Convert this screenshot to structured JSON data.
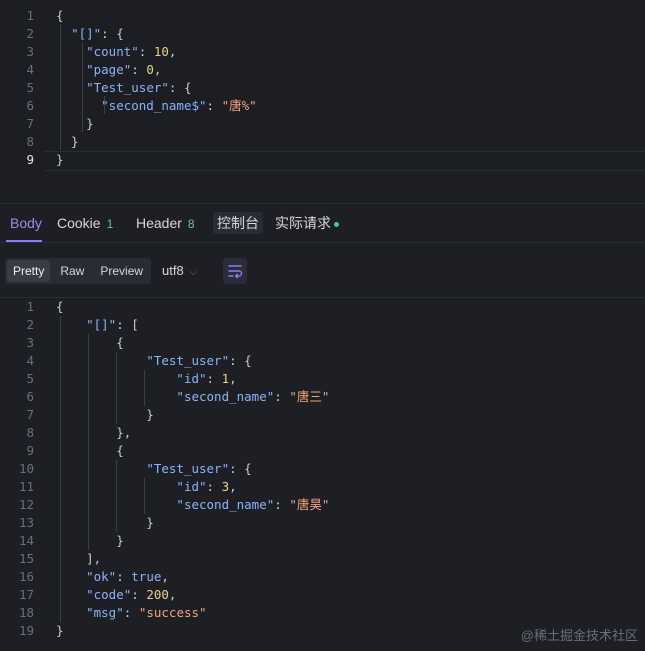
{
  "request_editor": {
    "line_numbers": [
      "1",
      "2",
      "3",
      "4",
      "5",
      "6",
      "7",
      "8",
      "9"
    ],
    "active_line": "9",
    "lines": [
      [
        {
          "t": "{",
          "c": "b"
        }
      ],
      [
        {
          "t": "  ",
          "c": "b"
        },
        {
          "t": "\"[]\"",
          "c": "k"
        },
        {
          "t": ": {",
          "c": "b"
        }
      ],
      [
        {
          "t": "    ",
          "c": "b"
        },
        {
          "t": "\"count\"",
          "c": "k"
        },
        {
          "t": ": ",
          "c": "b"
        },
        {
          "t": "10",
          "c": "n"
        },
        {
          "t": ",",
          "c": "b"
        }
      ],
      [
        {
          "t": "    ",
          "c": "b"
        },
        {
          "t": "\"page\"",
          "c": "k"
        },
        {
          "t": ": ",
          "c": "b"
        },
        {
          "t": "0",
          "c": "n"
        },
        {
          "t": ",",
          "c": "b"
        }
      ],
      [
        {
          "t": "    ",
          "c": "b"
        },
        {
          "t": "\"Test_user\"",
          "c": "k"
        },
        {
          "t": ": {",
          "c": "b"
        }
      ],
      [
        {
          "t": "      ",
          "c": "b"
        },
        {
          "t": "\"second_name$\"",
          "c": "k"
        },
        {
          "t": ": ",
          "c": "b"
        },
        {
          "t": "\"唐%\"",
          "c": "s"
        }
      ],
      [
        {
          "t": "    }",
          "c": "b"
        }
      ],
      [
        {
          "t": "  }",
          "c": "b"
        }
      ],
      [
        {
          "t": "}",
          "c": "b"
        }
      ]
    ]
  },
  "tabs": {
    "body": "Body",
    "cookie": "Cookie",
    "cookie_count": "1",
    "header": "Header",
    "header_count": "8",
    "console": "控制台",
    "actual_request": "实际请求"
  },
  "toolbar": {
    "pretty": "Pretty",
    "raw": "Raw",
    "preview": "Preview",
    "encoding": "utf8"
  },
  "response_editor": {
    "line_numbers": [
      "1",
      "2",
      "3",
      "4",
      "5",
      "6",
      "7",
      "8",
      "9",
      "10",
      "11",
      "12",
      "13",
      "14",
      "15",
      "16",
      "17",
      "18",
      "19"
    ],
    "lines": [
      [
        {
          "t": "{",
          "c": "b"
        }
      ],
      [
        {
          "t": "    ",
          "c": "b"
        },
        {
          "t": "\"[]\"",
          "c": "k"
        },
        {
          "t": ": [",
          "c": "b"
        }
      ],
      [
        {
          "t": "        {",
          "c": "b"
        }
      ],
      [
        {
          "t": "            ",
          "c": "b"
        },
        {
          "t": "\"Test_user\"",
          "c": "k"
        },
        {
          "t": ": {",
          "c": "b"
        }
      ],
      [
        {
          "t": "                ",
          "c": "b"
        },
        {
          "t": "\"id\"",
          "c": "k"
        },
        {
          "t": ": ",
          "c": "b"
        },
        {
          "t": "1",
          "c": "n"
        },
        {
          "t": ",",
          "c": "b"
        }
      ],
      [
        {
          "t": "                ",
          "c": "b"
        },
        {
          "t": "\"second_name\"",
          "c": "k"
        },
        {
          "t": ": ",
          "c": "b"
        },
        {
          "t": "\"唐三\"",
          "c": "s"
        }
      ],
      [
        {
          "t": "            }",
          "c": "b"
        }
      ],
      [
        {
          "t": "        },",
          "c": "b"
        }
      ],
      [
        {
          "t": "        {",
          "c": "b"
        }
      ],
      [
        {
          "t": "            ",
          "c": "b"
        },
        {
          "t": "\"Test_user\"",
          "c": "k"
        },
        {
          "t": ": {",
          "c": "b"
        }
      ],
      [
        {
          "t": "                ",
          "c": "b"
        },
        {
          "t": "\"id\"",
          "c": "k"
        },
        {
          "t": ": ",
          "c": "b"
        },
        {
          "t": "3",
          "c": "n"
        },
        {
          "t": ",",
          "c": "b"
        }
      ],
      [
        {
          "t": "                ",
          "c": "b"
        },
        {
          "t": "\"second_name\"",
          "c": "k"
        },
        {
          "t": ": ",
          "c": "b"
        },
        {
          "t": "\"唐昊\"",
          "c": "s"
        }
      ],
      [
        {
          "t": "            }",
          "c": "b"
        }
      ],
      [
        {
          "t": "        }",
          "c": "b"
        }
      ],
      [
        {
          "t": "    ],",
          "c": "b"
        }
      ],
      [
        {
          "t": "    ",
          "c": "b"
        },
        {
          "t": "\"ok\"",
          "c": "k"
        },
        {
          "t": ": ",
          "c": "b"
        },
        {
          "t": "true",
          "c": "lit"
        },
        {
          "t": ",",
          "c": "b"
        }
      ],
      [
        {
          "t": "    ",
          "c": "b"
        },
        {
          "t": "\"code\"",
          "c": "k"
        },
        {
          "t": ": ",
          "c": "b"
        },
        {
          "t": "200",
          "c": "n"
        },
        {
          "t": ",",
          "c": "b"
        }
      ],
      [
        {
          "t": "    ",
          "c": "b"
        },
        {
          "t": "\"msg\"",
          "c": "k"
        },
        {
          "t": ": ",
          "c": "b"
        },
        {
          "t": "\"success\"",
          "c": "s"
        }
      ],
      [
        {
          "t": "}",
          "c": "b"
        }
      ]
    ]
  },
  "watermark": "@稀土掘金技术社区",
  "colors": {
    "accent": "#8b7cf0",
    "key": "#8ab4f8",
    "string": "#f2a57a",
    "number": "#e8d28a",
    "badge_green": "#69c58e"
  }
}
